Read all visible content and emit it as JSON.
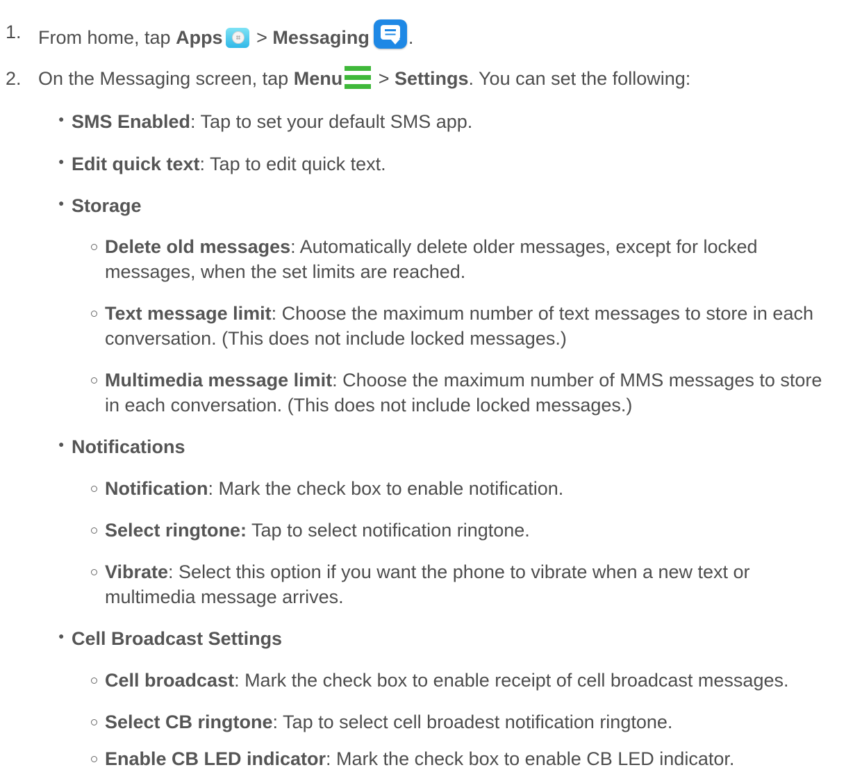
{
  "steps": [
    {
      "number": "1.",
      "text_a": "From home, tap ",
      "apps_label": "Apps",
      "apps_icon": "apps-icon",
      "separator": " > ",
      "messaging_label": "Messaging",
      "messaging_icon": "messaging-icon",
      "text_end": "."
    },
    {
      "number": "2.",
      "text_a": "On the Messaging screen, tap ",
      "menu_label": "Menu",
      "menu_icon": "menu-icon",
      "separator": " > ",
      "settings_label": "Settings",
      "text_end": ". You can set the following:"
    }
  ],
  "settings": {
    "sms_enabled": {
      "label": "SMS Enabled",
      "desc": ": Tap to set your default SMS app."
    },
    "edit_quick_text": {
      "label": "Edit quick text",
      "desc": ": Tap to edit quick text."
    },
    "storage": {
      "heading": "Storage",
      "delete_old": {
        "label": "Delete old messages",
        "desc1": ": Automatically delete older messages, except for locked",
        "desc2": "messages, when the set limits are reached."
      },
      "text_limit": {
        "label": "Text message limit",
        "desc1": ": Choose the maximum number of text messages to store in each",
        "desc2": "conversation. (This does not include locked messages.)"
      },
      "mms_limit": {
        "label": "Multimedia message limit",
        "desc1": ": Choose the maximum number of MMS messages to store",
        "desc2": "in each conversation. (This does not include locked messages.)"
      }
    },
    "notifications": {
      "heading": "Notifications",
      "notification": {
        "label": "Notification",
        "desc": ": Mark the check box to enable notification."
      },
      "select_ringtone": {
        "label": "Select ringtone:",
        "desc": " Tap to select notification ringtone."
      },
      "vibrate": {
        "label": "Vibrate",
        "desc1": ": Select this option if you want the phone to vibrate when a new text or",
        "desc2": "multimedia message arrives."
      }
    },
    "cell_broadcast": {
      "heading": "Cell Broadcast Settings",
      "cell_broadcast": {
        "label": "Cell broadcast",
        "desc": ": Mark the check box to enable receipt of cell broadcast messages."
      },
      "select_cb_ringtone": {
        "label": "Select CB ringtone",
        "desc": ": Tap to select cell broadest notification ringtone."
      },
      "enable_cb_led": {
        "label": "Enable CB LED indicator",
        "desc": ": Mark the check box to enable CB LED indicator."
      }
    }
  },
  "colors": {
    "text": "#4d4d4d",
    "menu_icon": "#3fb83a",
    "messaging_icon": "#1e88e5",
    "apps_icon": "#2fb8e8"
  }
}
